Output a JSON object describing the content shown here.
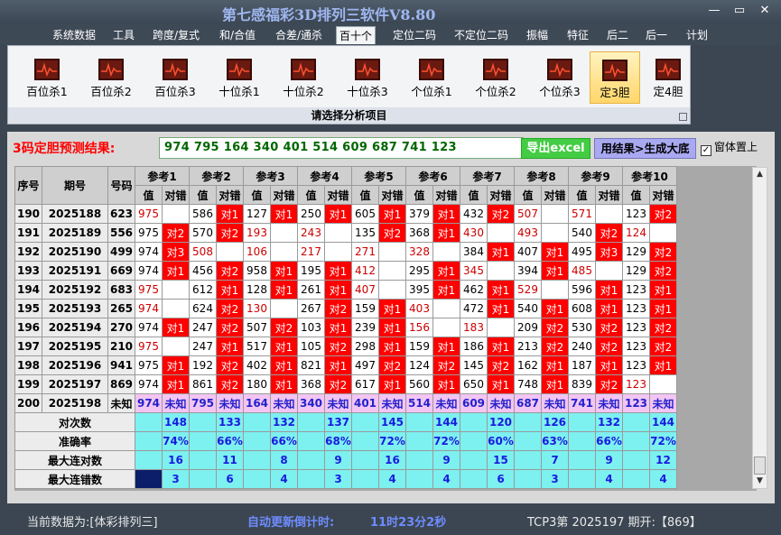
{
  "window": {
    "title": "第七感福彩3D排列三软件V8.80",
    "min": "—",
    "max": "▭",
    "close": "✕"
  },
  "menu": [
    "系统数据",
    "工具",
    "跨度/复式",
    "和/合值",
    "合差/通杀",
    "百十个",
    "定位二码",
    "不定位二码",
    "振幅",
    "特征",
    "后二",
    "后一",
    "计划"
  ],
  "menu_active": 5,
  "ribbon": {
    "buttons": [
      "百位杀1",
      "百位杀2",
      "百位杀3",
      "十位杀1",
      "十位杀2",
      "十位杀3",
      "个位杀1",
      "个位杀2",
      "个位杀3",
      "定3胆",
      "定4胆"
    ],
    "selected": 9,
    "footer": "请选择分析项目"
  },
  "predict": {
    "label": "3码定胆预测结果:",
    "value": "974 795 164 340 401 514 609 687 741 123",
    "excel_btn": "导出excel",
    "result_btn": "用结果>生成大底",
    "topmost": "窗体置上"
  },
  "table": {
    "headers": {
      "idx": "序号",
      "period": "期号",
      "num": "号码",
      "val": "值",
      "mark": "对错"
    },
    "refs": [
      "参考1",
      "参考2",
      "参考3",
      "参考4",
      "参考5",
      "参考6",
      "参考7",
      "参考8",
      "参考9",
      "参考10"
    ],
    "rows": [
      {
        "idx": "190",
        "period": "2025188",
        "num": "623",
        "cells": [
          [
            "975",
            0,
            ""
          ],
          [
            "586",
            1,
            "对1"
          ],
          [
            "127",
            1,
            "对1"
          ],
          [
            "250",
            1,
            "对1"
          ],
          [
            "605",
            1,
            "对1"
          ],
          [
            "379",
            1,
            "对1"
          ],
          [
            "432",
            1,
            "对2"
          ],
          [
            "507",
            0,
            ""
          ],
          [
            "571",
            0,
            ""
          ],
          [
            "123",
            1,
            "对2"
          ]
        ]
      },
      {
        "idx": "191",
        "period": "2025189",
        "num": "556",
        "cells": [
          [
            "975",
            1,
            "对2"
          ],
          [
            "570",
            1,
            "对2"
          ],
          [
            "193",
            0,
            ""
          ],
          [
            "243",
            0,
            ""
          ],
          [
            "135",
            1,
            "对2"
          ],
          [
            "368",
            1,
            "对1"
          ],
          [
            "430",
            0,
            ""
          ],
          [
            "493",
            0,
            ""
          ],
          [
            "540",
            1,
            "对2"
          ],
          [
            "124",
            0,
            ""
          ]
        ]
      },
      {
        "idx": "192",
        "period": "2025190",
        "num": "499",
        "cells": [
          [
            "974",
            1,
            "对3"
          ],
          [
            "508",
            0,
            ""
          ],
          [
            "106",
            0,
            ""
          ],
          [
            "217",
            0,
            ""
          ],
          [
            "271",
            0,
            ""
          ],
          [
            "328",
            0,
            ""
          ],
          [
            "384",
            1,
            "对1"
          ],
          [
            "407",
            1,
            "对1"
          ],
          [
            "495",
            1,
            "对3"
          ],
          [
            "129",
            1,
            "对2"
          ]
        ]
      },
      {
        "idx": "193",
        "period": "2025191",
        "num": "669",
        "cells": [
          [
            "974",
            1,
            "对1"
          ],
          [
            "456",
            1,
            "对2"
          ],
          [
            "958",
            1,
            "对1"
          ],
          [
            "195",
            1,
            "对1"
          ],
          [
            "412",
            0,
            ""
          ],
          [
            "295",
            1,
            "对1"
          ],
          [
            "345",
            0,
            ""
          ],
          [
            "394",
            1,
            "对1"
          ],
          [
            "485",
            0,
            ""
          ],
          [
            "129",
            1,
            "对2"
          ]
        ]
      },
      {
        "idx": "194",
        "period": "2025192",
        "num": "683",
        "cells": [
          [
            "975",
            0,
            ""
          ],
          [
            "612",
            1,
            "对1"
          ],
          [
            "128",
            1,
            "对1"
          ],
          [
            "261",
            1,
            "对1"
          ],
          [
            "407",
            0,
            ""
          ],
          [
            "395",
            1,
            "对1"
          ],
          [
            "462",
            1,
            "对1"
          ],
          [
            "529",
            0,
            ""
          ],
          [
            "596",
            1,
            "对1"
          ],
          [
            "123",
            1,
            "对1"
          ]
        ]
      },
      {
        "idx": "195",
        "period": "2025193",
        "num": "265",
        "cells": [
          [
            "974",
            0,
            ""
          ],
          [
            "624",
            1,
            "对2"
          ],
          [
            "130",
            0,
            ""
          ],
          [
            "267",
            1,
            "对2"
          ],
          [
            "159",
            1,
            "对1"
          ],
          [
            "403",
            0,
            ""
          ],
          [
            "472",
            1,
            "对1"
          ],
          [
            "540",
            1,
            "对1"
          ],
          [
            "608",
            1,
            "对1"
          ],
          [
            "123",
            1,
            "对1"
          ]
        ]
      },
      {
        "idx": "196",
        "period": "2025194",
        "num": "270",
        "cells": [
          [
            "974",
            1,
            "对1"
          ],
          [
            "247",
            1,
            "对2"
          ],
          [
            "507",
            1,
            "对2"
          ],
          [
            "103",
            1,
            "对1"
          ],
          [
            "239",
            1,
            "对1"
          ],
          [
            "156",
            0,
            ""
          ],
          [
            "183",
            0,
            ""
          ],
          [
            "209",
            1,
            "对2"
          ],
          [
            "530",
            1,
            "对2"
          ],
          [
            "123",
            1,
            "对2"
          ]
        ]
      },
      {
        "idx": "197",
        "period": "2025195",
        "num": "210",
        "cells": [
          [
            "975",
            0,
            ""
          ],
          [
            "247",
            1,
            "对1"
          ],
          [
            "517",
            1,
            "对1"
          ],
          [
            "105",
            1,
            "对2"
          ],
          [
            "298",
            1,
            "对1"
          ],
          [
            "159",
            1,
            "对1"
          ],
          [
            "186",
            1,
            "对1"
          ],
          [
            "213",
            1,
            "对2"
          ],
          [
            "240",
            1,
            "对2"
          ],
          [
            "123",
            1,
            "对2"
          ]
        ]
      },
      {
        "idx": "198",
        "period": "2025196",
        "num": "941",
        "cells": [
          [
            "975",
            1,
            "对1"
          ],
          [
            "192",
            1,
            "对2"
          ],
          [
            "402",
            1,
            "对1"
          ],
          [
            "821",
            1,
            "对1"
          ],
          [
            "497",
            1,
            "对2"
          ],
          [
            "124",
            1,
            "对2"
          ],
          [
            "145",
            1,
            "对2"
          ],
          [
            "162",
            1,
            "对1"
          ],
          [
            "187",
            1,
            "对1"
          ],
          [
            "123",
            1,
            "对1"
          ]
        ]
      },
      {
        "idx": "199",
        "period": "2025197",
        "num": "869",
        "cells": [
          [
            "974",
            1,
            "对1"
          ],
          [
            "861",
            1,
            "对2"
          ],
          [
            "180",
            1,
            "对1"
          ],
          [
            "368",
            1,
            "对2"
          ],
          [
            "617",
            1,
            "对1"
          ],
          [
            "560",
            1,
            "对1"
          ],
          [
            "650",
            1,
            "对1"
          ],
          [
            "748",
            1,
            "对1"
          ],
          [
            "839",
            1,
            "对2"
          ],
          [
            "123",
            0,
            ""
          ]
        ]
      }
    ],
    "pred_row": {
      "idx": "200",
      "period": "2025198",
      "num": "未知",
      "vals": [
        "974",
        "795",
        "164",
        "340",
        "401",
        "514",
        "609",
        "687",
        "741",
        "123"
      ],
      "mark": "未知"
    },
    "stats": [
      {
        "label": "对次数",
        "vals": [
          "148",
          "133",
          "132",
          "137",
          "145",
          "144",
          "120",
          "126",
          "132",
          "144"
        ]
      },
      {
        "label": "准确率",
        "vals": [
          "74%",
          "66%",
          "66%",
          "68%",
          "72%",
          "72%",
          "60%",
          "63%",
          "66%",
          "72%"
        ]
      },
      {
        "label": "最大连对数",
        "vals": [
          "16",
          "11",
          "8",
          "9",
          "16",
          "9",
          "15",
          "7",
          "9",
          "12"
        ]
      },
      {
        "label": "最大连错数",
        "vals": [
          "3",
          "6",
          "4",
          "3",
          "4",
          "4",
          "6",
          "3",
          "4",
          "4"
        ]
      }
    ]
  },
  "status": {
    "data_label": "当前数据为:[体彩排列三]",
    "countdown_label": "自动更新倒计时:",
    "countdown_value": "11时23分2秒",
    "issue": "TCP3第 2025197 期开:【869】"
  },
  "colors": {
    "hit": "#ff0000",
    "miss_val": "#cc0000",
    "pred_row": "#f3c5f3",
    "stats": "#7df0f0",
    "title": "#9fb7f0"
  }
}
